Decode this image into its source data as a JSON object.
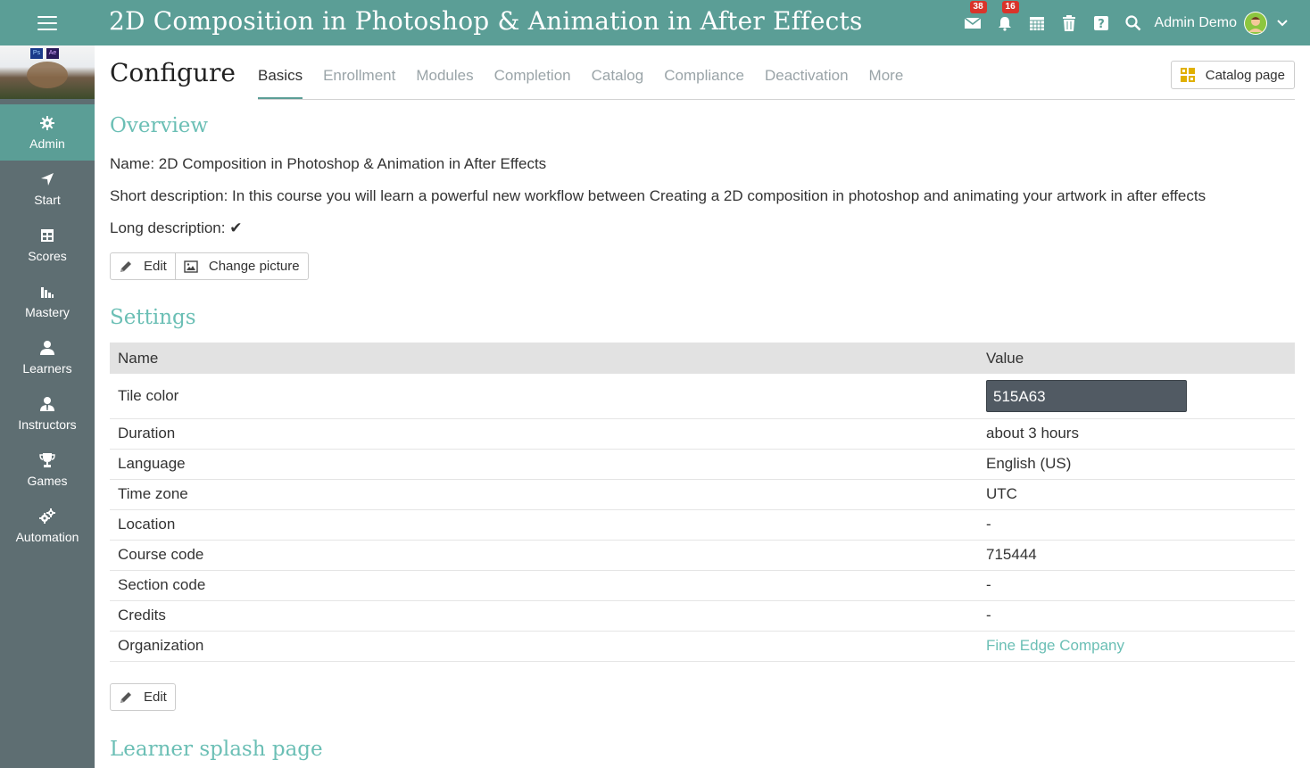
{
  "header": {
    "course_title": "2D Composition in Photoshop & Animation in After Effects",
    "messages_badge": "38",
    "notifications_badge": "16",
    "user_name": "Admin Demo"
  },
  "sidebar": {
    "thumb_ps": "Ps",
    "thumb_ae": "Ae",
    "items": [
      {
        "label": "Admin",
        "icon": "gear-icon"
      },
      {
        "label": "Start",
        "icon": "location-arrow-icon"
      },
      {
        "label": "Scores",
        "icon": "table-icon"
      },
      {
        "label": "Mastery",
        "icon": "bar-chart-icon"
      },
      {
        "label": "Learners",
        "icon": "user-icon"
      },
      {
        "label": "Instructors",
        "icon": "instructor-icon"
      },
      {
        "label": "Games",
        "icon": "trophy-icon"
      },
      {
        "label": "Automation",
        "icon": "gears-icon"
      }
    ]
  },
  "page": {
    "title": "Configure",
    "tabs": [
      "Basics",
      "Enrollment",
      "Modules",
      "Completion",
      "Catalog",
      "Compliance",
      "Deactivation",
      "More"
    ],
    "catalog_button": "Catalog page"
  },
  "overview": {
    "title": "Overview",
    "name_line": "Name: 2D Composition in Photoshop & Animation in After Effects",
    "short_desc_line": "Short description: In this course you will learn a powerful new workflow between Creating a 2D composition in photoshop and animating your artwork in after effects",
    "long_desc_label": "Long description:",
    "long_desc_check": "✔",
    "edit_label": "Edit",
    "change_picture_label": "Change picture"
  },
  "settings": {
    "title": "Settings",
    "col_name": "Name",
    "col_value": "Value",
    "rows": [
      {
        "name": "Tile color",
        "value": "515A63"
      },
      {
        "name": "Duration",
        "value": "about 3 hours"
      },
      {
        "name": "Language",
        "value": "English (US)"
      },
      {
        "name": "Time zone",
        "value": "UTC"
      },
      {
        "name": "Location",
        "value": "-"
      },
      {
        "name": "Course code",
        "value": "715444"
      },
      {
        "name": "Section code",
        "value": "-"
      },
      {
        "name": "Credits",
        "value": "-"
      },
      {
        "name": "Organization",
        "value": "Fine Edge Company"
      }
    ],
    "edit_label": "Edit",
    "tile_color_hex": "#515A63"
  },
  "splash": {
    "title": "Learner splash page"
  },
  "colors": {
    "brand": "#5b9e96",
    "sidebar": "#5e6e72",
    "accent_text": "#6bbfb5"
  }
}
